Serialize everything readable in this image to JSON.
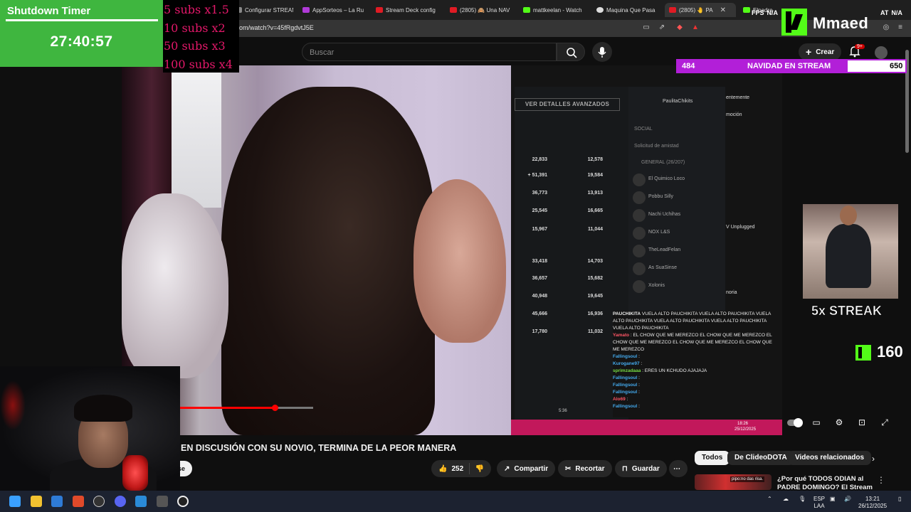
{
  "browser": {
    "tabs": [
      {
        "label": "Configurar STREAM",
        "color": "#888888"
      },
      {
        "label": "AppSorteos – La Ru",
        "color": "#b03ad8"
      },
      {
        "label": "Stream Deck config",
        "color": "#e01b24"
      },
      {
        "label": "(2805) 🙈 Una NAV",
        "color": "#e01b24"
      },
      {
        "label": "mattkeelan - Watch",
        "color": "#53fc18"
      },
      {
        "label": "Maquina Que Pasa",
        "color": "#dddddd"
      },
      {
        "label": "(2805) 🤚 PA",
        "color": "#e01b24"
      },
      {
        "label": "Elpadre",
        "color": "#53fc18"
      }
    ],
    "active_tab_index": 6,
    "url": "om/watch?v=45fRgdvtJ5E",
    "fps_label": "FPS",
    "fps_value": "N/A",
    "stat_label": "AT",
    "stat_value": "N/A"
  },
  "youtube_header": {
    "search_placeholder": "Buscar",
    "create_label": "Crear",
    "notification_badge": "9+"
  },
  "timer": {
    "title": "Shutdown Timer",
    "value": "27:40:57"
  },
  "subs_multipliers": [
    "5 subs x1.5",
    "10 subs x2",
    "50 subs x3",
    "100 subs x4"
  ],
  "kick": {
    "channel": "Mmaed",
    "goal_current": "484",
    "goal_name": "NAVIDAD EN STREAM",
    "goal_max": "650",
    "goal_progress": 0.745,
    "streak_text": "5x STREAK",
    "count": "160",
    "brand_color": "#53fc18",
    "goal_color": "#b21fd8"
  },
  "video_content": {
    "advanced_button": "VER DETALLES AVANZADOS",
    "stats": [
      {
        "a": "22,833",
        "b": "12,578"
      },
      {
        "a": "+ 51,391",
        "b": "19,584"
      },
      {
        "a": "36,773",
        "b": "13,913"
      },
      {
        "a": "25,545",
        "b": "16,665"
      },
      {
        "a": "15,967",
        "b": "11,044"
      },
      {
        "a": "33,418",
        "b": "14,703"
      },
      {
        "a": "36,657",
        "b": "15,682"
      },
      {
        "a": "40,948",
        "b": "19,645"
      },
      {
        "a": "45,666",
        "b": "16,936"
      },
      {
        "a": "17,780",
        "b": "11,032"
      }
    ],
    "social_user": "PaulitaChikits",
    "social_label": "SOCIAL",
    "friend_request": "Solicitud de amistad",
    "general_label": "GENERAL (26/207)",
    "friends": [
      "El Quimico Loco",
      "Pobbu Silly",
      "Nachi Uchihas",
      "NOX L&S",
      "TheLeadFelan",
      "As SuaSinse",
      "Xolonis"
    ],
    "side_texts": [
      "entemente",
      "moción",
      "V Unplugged",
      "noria"
    ],
    "chat_lines": [
      {
        "user": "PAUCHIKITA",
        "text": "VUELA ALTO PAUCHIKITA VUELA ALTO PAUCHIKITA VUELA ALTO PAUCHIKITA VUELA ALTO PAUCHIKITA VUELA ALTO PAUCHIKITA VUELA ALTO PAUCHIKITA",
        "cls": "u0"
      },
      {
        "user": "Yamato",
        "text": ": EL CHOW QUE ME MEREZCO EL CHOW QUE ME MEREZCO EL CHOW QUE ME MEREZCO EL CHOW QUE ME MEREZCO EL CHOW QUE ME MEREZCO",
        "cls": "u1"
      },
      {
        "user": "Fallingsoul",
        "text": ":",
        "cls": "u2"
      },
      {
        "user": "Kurogane97",
        "text": ":",
        "cls": "u2"
      },
      {
        "user": "sprimzadaaa",
        "text": ": ERES UN KCHUDO AJAJAJA",
        "cls": "u3"
      },
      {
        "user": "Fallingsoul",
        "text": ":",
        "cls": "u2"
      },
      {
        "user": "Fallingsoul",
        "text": ":",
        "cls": "u2"
      },
      {
        "user": "Fallingsoul",
        "text": ":",
        "cls": "u2"
      },
      {
        "user": "Alo69",
        "text": ":",
        "cls": "u1"
      },
      {
        "user": "Fallingsoul",
        "text": ":",
        "cls": "u2"
      }
    ],
    "inner_time": "5:36",
    "inner_clock": "18:26",
    "inner_date": "25/12/2025"
  },
  "video": {
    "title": "EN DISCUSIÓN CON SU NOVIO, TERMINA DE LA PEOR MANERA",
    "progress": 0.71,
    "subscribe_label": "se",
    "likes": "252",
    "share_label": "Compartir",
    "clip_label": "Recortar",
    "save_label": "Guardar"
  },
  "chips": [
    "Todos",
    "De ClideoDOTA",
    "Videos relacionados"
  ],
  "recommended": {
    "title": "¿Por qué TODOS ODIAN al PADRE DOMINGO? El Stream",
    "overlay": "pipo:no das risa."
  },
  "taskbar": {
    "language": "ESP",
    "layout": "LAA",
    "time": "13:21",
    "date": "26/12/2025"
  }
}
